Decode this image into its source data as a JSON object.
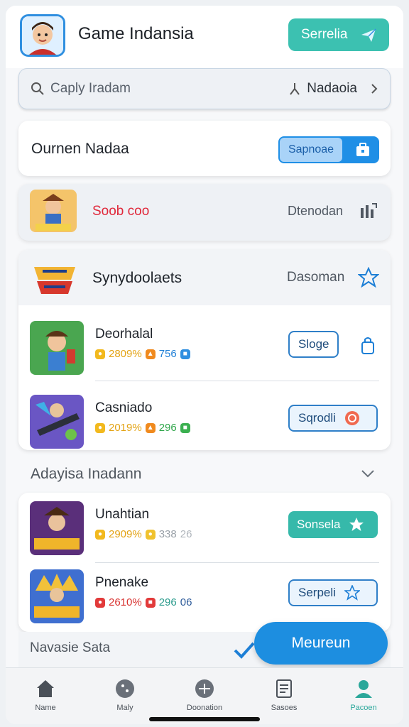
{
  "header": {
    "app_title": "Game Indansia",
    "action_label": "Serrelia"
  },
  "search": {
    "placeholder": "Caply Iradam",
    "location": "Nadaoia"
  },
  "owner": {
    "name": "Ournen Nadaa",
    "toggle_label": "Sapnoae"
  },
  "promo": {
    "title": "Soob coo",
    "right_label": "Dtenodan"
  },
  "list": {
    "header_title": "Synydoolaets",
    "header_right": "Dasoman",
    "items": [
      {
        "title": "Deorhalal",
        "s1": "2809%",
        "s2": "756",
        "button": "Sloge"
      },
      {
        "title": "Casniado",
        "s1": "2019%",
        "s2": "296",
        "button": "Sqrodli"
      }
    ]
  },
  "section": {
    "title": "Adayisa Inadann"
  },
  "list2": {
    "items": [
      {
        "title": "Unahtian",
        "s1": "2909%",
        "s2": "338",
        "s3": "26",
        "button": "Sonsela"
      },
      {
        "title": "Pnenake",
        "s1": "2610%",
        "s2": "296",
        "s3": "06",
        "button": "Serpeli"
      }
    ]
  },
  "section2": {
    "title": "Navasie Sata"
  },
  "fab": {
    "label": "Meureun"
  },
  "nav": [
    {
      "label": "Name",
      "icon": "home-icon"
    },
    {
      "label": "Maly",
      "icon": "circle-icon"
    },
    {
      "label": "Doonation",
      "icon": "compass-icon"
    },
    {
      "label": "Sasoes",
      "icon": "document-icon"
    },
    {
      "label": "Pacoen",
      "icon": "profile-icon"
    }
  ],
  "colors": {
    "accent_teal": "#36b9aa",
    "accent_blue": "#1d8ee0",
    "promo_red": "#e0283a"
  }
}
